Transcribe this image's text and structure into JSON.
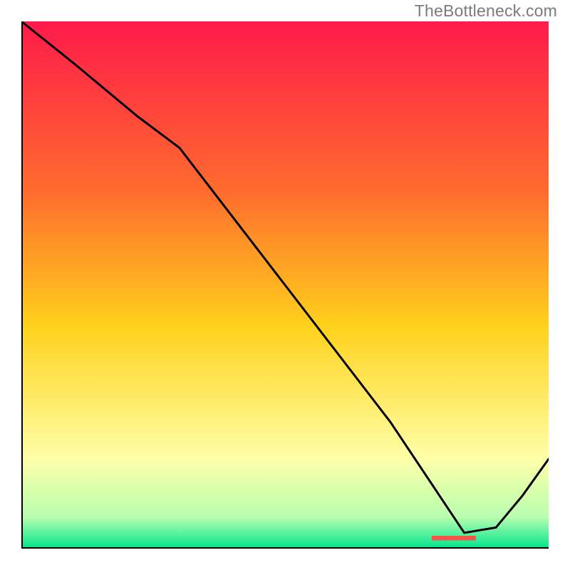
{
  "watermark": "TheBottleneck.com",
  "colors": {
    "line": "#000000",
    "axis": "#000000",
    "marker": "#ff4e46",
    "gradient_top": "#ff1a4a",
    "gradient_upper": "#ff6b2e",
    "gradient_mid": "#ffd21c",
    "gradient_lower": "#ffffa8",
    "gradient_bottom1": "#b8ffb0",
    "gradient_bottom2": "#00e58c"
  },
  "chart_data": {
    "type": "line",
    "title": "",
    "xlabel": "",
    "ylabel": "",
    "xlim": [
      0,
      100
    ],
    "ylim": [
      0,
      100
    ],
    "grid": false,
    "legend": false,
    "annotations": [],
    "series": [
      {
        "name": "curve",
        "x": [
          0,
          10,
          22,
          30,
          40,
          50,
          60,
          70,
          78,
          84,
          90,
          95,
          100
        ],
        "y": [
          100,
          92,
          82,
          76,
          63,
          50,
          37,
          24,
          12,
          3,
          4,
          10,
          17
        ]
      }
    ],
    "markers": [
      {
        "name": "dense-segment",
        "x_start": 78,
        "x_end": 86,
        "y": 2
      }
    ]
  }
}
